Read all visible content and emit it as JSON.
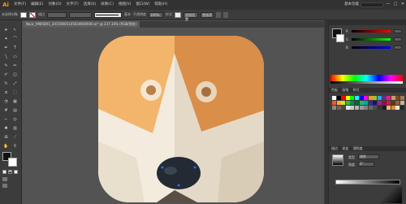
{
  "app": {
    "logo": "Ai",
    "menu": [
      "文件(F)",
      "编辑(E)",
      "对象(O)",
      "文字(T)",
      "选择(S)",
      "效果(C)",
      "视图(V)",
      "窗口(W)",
      "帮助(H)"
    ],
    "workspace_label": "基本功能",
    "win_controls": [
      "—",
      "□",
      "✕"
    ]
  },
  "controlbar": {
    "label_none": "未选择对象",
    "stroke_label": "描边",
    "stroke_value": "",
    "brush_label": "基本",
    "opacity_label": "不透明度",
    "opacity_value": "100%",
    "style_label": "样式",
    "doc_setup": "文档设置",
    "prefs": "首选项"
  },
  "document": {
    "tab_title": "Nipic_9985801_20150605105634600000.ai* @ 237.16% (RGB/预览)"
  },
  "panels": {
    "color_sliders": [
      {
        "label": "R",
        "value": ""
      },
      {
        "label": "G",
        "value": ""
      },
      {
        "label": "B",
        "value": ""
      }
    ],
    "swatches_tab": "色板",
    "brush_tab": "画笔",
    "symbol_tab": "符号",
    "stroke_tab": "描边",
    "gradient_tab": "渐变",
    "transparency_tab": "透明度",
    "gradient_type_label": "类型",
    "gradient_type_value": "线性",
    "gradient_angle_label": "角度",
    "gradient_angle_value": "0°"
  },
  "colors": {
    "face_light": "#f2b66b",
    "face_dark": "#d98b45",
    "muzzle": "#efe6d5",
    "nose": "#232a33",
    "background": "#535353"
  }
}
